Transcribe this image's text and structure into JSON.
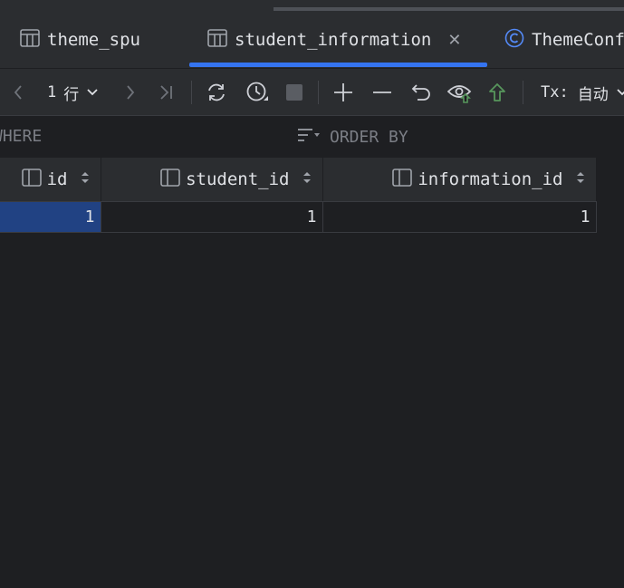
{
  "tabs": [
    {
      "label": "theme_spu",
      "icon": "table-icon",
      "active": false
    },
    {
      "label": "student_information",
      "icon": "table-icon",
      "active": true
    },
    {
      "label": "ThemeConf",
      "icon": "class-icon",
      "active": false
    }
  ],
  "toolbar": {
    "rows_value": "1",
    "rows_unit": "行",
    "tx_label": "Tx:",
    "tx_mode": "自动"
  },
  "filter": {
    "where_label": "WHERE",
    "orderby_label": "ORDER BY"
  },
  "grid": {
    "columns": [
      "id",
      "student_id",
      "information_id"
    ],
    "rows": [
      [
        "1",
        "1",
        "1"
      ]
    ]
  },
  "colors": {
    "accent": "#3574f0",
    "selection": "#214283",
    "background": "#1e1f22",
    "panel": "#2b2d30"
  }
}
